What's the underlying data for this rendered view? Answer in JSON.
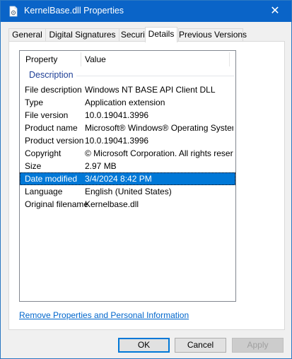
{
  "window": {
    "title": "KernelBase.dll Properties",
    "close_glyph": "✕"
  },
  "tabs": [
    {
      "label": "General"
    },
    {
      "label": "Digital Signatures"
    },
    {
      "label": "Security"
    },
    {
      "label": "Details",
      "active": true
    },
    {
      "label": "Previous Versions"
    }
  ],
  "details": {
    "header": {
      "property": "Property",
      "value": "Value"
    },
    "group": "Description",
    "rows": [
      {
        "property": "File description",
        "value": "Windows NT BASE API Client DLL"
      },
      {
        "property": "Type",
        "value": "Application extension"
      },
      {
        "property": "File version",
        "value": "10.0.19041.3996"
      },
      {
        "property": "Product name",
        "value": "Microsoft® Windows® Operating System"
      },
      {
        "property": "Product version",
        "value": "10.0.19041.3996"
      },
      {
        "property": "Copyright",
        "value": "© Microsoft Corporation. All rights reserv..."
      },
      {
        "property": "Size",
        "value": "2.97 MB"
      },
      {
        "property": "Date modified",
        "value": "3/4/2024 8:42 PM",
        "selected": true
      },
      {
        "property": "Language",
        "value": "English (United States)"
      },
      {
        "property": "Original filename",
        "value": "Kernelbase.dll"
      }
    ]
  },
  "footer": {
    "link": "Remove Properties and Personal Information",
    "ok": "OK",
    "cancel": "Cancel",
    "apply": "Apply"
  },
  "colors": {
    "titlebar": "#0a64c8",
    "selection": "#0078d7",
    "group_label": "#1e3f96",
    "link": "#0066cc"
  }
}
